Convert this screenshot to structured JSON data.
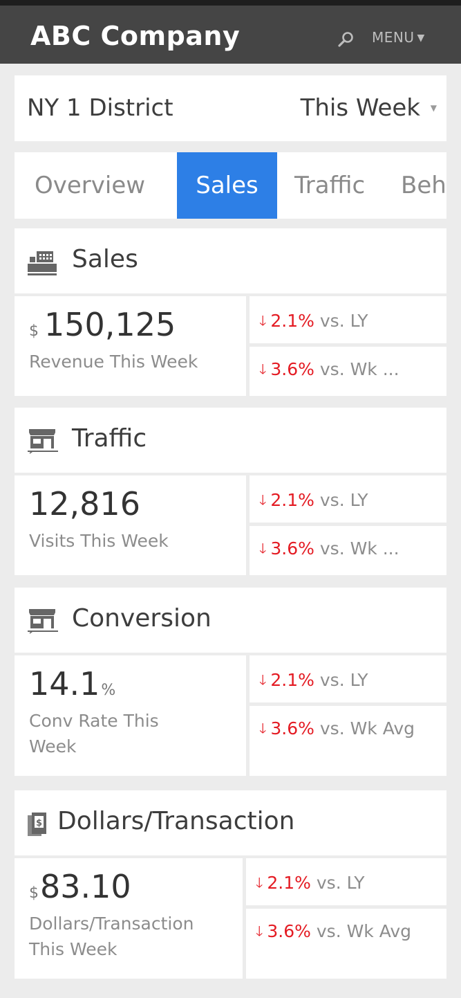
{
  "header": {
    "title": "ABC Company",
    "menu_label": "MENU"
  },
  "selector": {
    "district": "NY 1 District",
    "period": "This Week"
  },
  "tabs": [
    {
      "label": "Overview"
    },
    {
      "label": "Sales"
    },
    {
      "label": "Traffic"
    },
    {
      "label": "Beh"
    }
  ],
  "sections": {
    "sales": {
      "title": "Sales",
      "unit_prefix": "$",
      "value": "150,125",
      "label": "Revenue This Week",
      "compare_ly_pct": "2.1%",
      "compare_ly_text": "vs. LY",
      "compare_wk_pct": "3.6%",
      "compare_wk_text": "vs. Wk ..."
    },
    "traffic": {
      "title": "Traffic",
      "value": "12,816",
      "label": "Visits This Week",
      "compare_ly_pct": "2.1%",
      "compare_ly_text": "vs. LY",
      "compare_wk_pct": "3.6%",
      "compare_wk_text": "vs. Wk ..."
    },
    "conversion": {
      "title": "Conversion",
      "value": "14.1",
      "unit_suffix": "%",
      "label": "Conv Rate This Week",
      "compare_ly_pct": "2.1%",
      "compare_ly_text": "vs. LY",
      "compare_wk_pct": "3.6%",
      "compare_wk_text": "vs. Wk Avg"
    },
    "dpt": {
      "title": "Dollars/Transaction",
      "unit_prefix": "$",
      "value": "83.10",
      "label": "Dollars/Transaction This Week",
      "compare_ly_pct": "2.1%",
      "compare_ly_text": "vs. LY",
      "compare_wk_pct": "3.6%",
      "compare_wk_text": "vs. Wk Avg"
    }
  },
  "colors": {
    "header_bg": "#454545",
    "active_tab": "#2d7fe6",
    "negative": "#e41b23",
    "page_bg": "#ececec"
  },
  "icons": {
    "search": "search-icon",
    "sales": "cash-register-icon",
    "traffic": "storefront-icon",
    "conversion": "storefront-icon",
    "dpt": "receipt-dollar-icon",
    "trend_down": "arrow-down-icon"
  }
}
